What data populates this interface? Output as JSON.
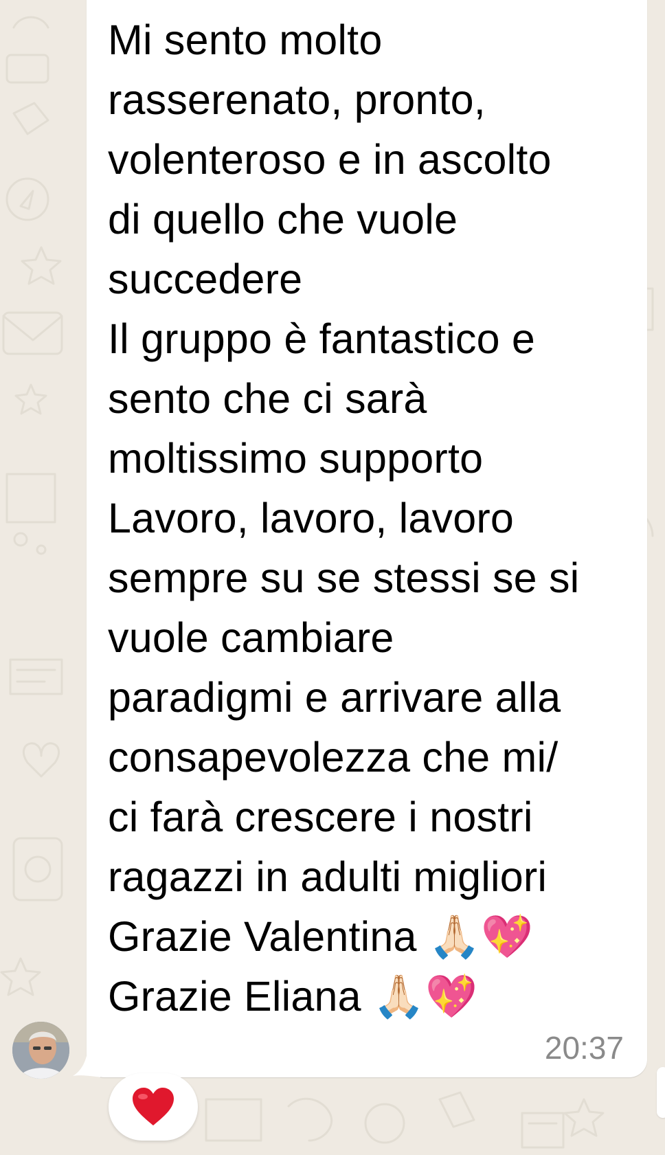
{
  "message": {
    "text": "Mi sento molto\nrasserenato, pronto,\nvolenteroso e in ascolto\ndi quello che vuole\nsuccedere\nIl gruppo è fantastico e\nsento che ci sarà\nmoltissimo supporto\nLavoro, lavoro, lavoro\nsempre su se stessi se si\nvuole cambiare\nparadigmi e arrivare alla\nconsapevolezza che mi/\nci farà crescere i nostri\nragazzi in adulti migliori\nGrazie Valentina 🙏🏻💖\nGrazie Eliana 🙏🏻💖",
    "time": "20:37"
  },
  "reaction": {
    "emoji": "heart",
    "color": "#e0182d"
  },
  "colors": {
    "background": "#efeae2",
    "bubble": "#ffffff",
    "timestamp": "#8a8a8a"
  }
}
